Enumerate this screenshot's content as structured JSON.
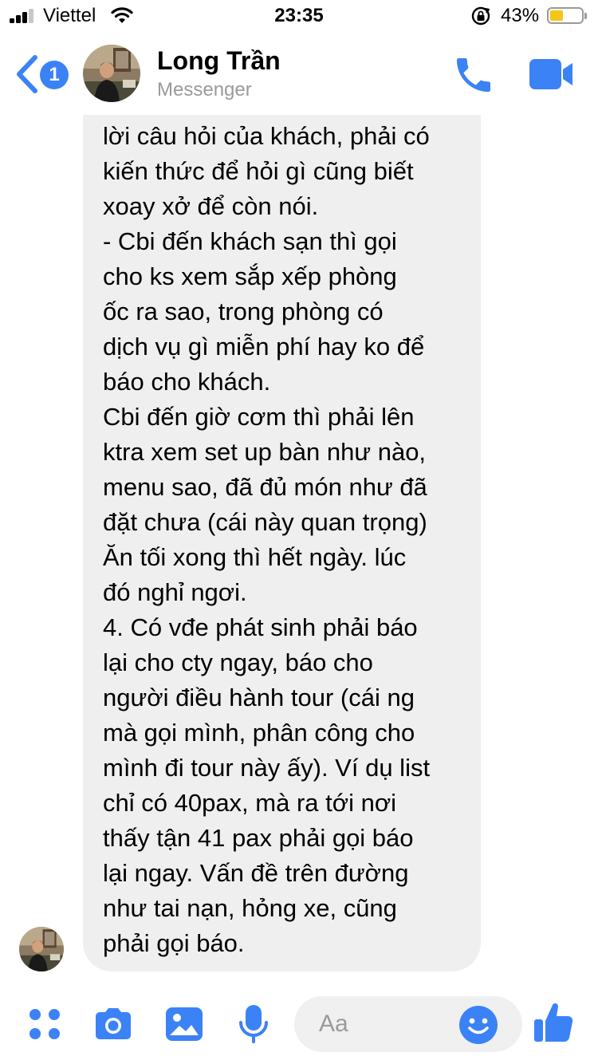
{
  "status_bar": {
    "carrier": "Viettel",
    "time": "23:35",
    "battery_percent_label": "43%",
    "battery_level": 0.43,
    "icons": [
      "signal-icon",
      "wifi-icon",
      "orientation-lock-icon",
      "battery-icon"
    ]
  },
  "header": {
    "unread_count": "1",
    "contact_name": "Long Trần",
    "contact_subtitle": "Messenger",
    "icons": [
      "back-chevron-icon",
      "phone-icon",
      "video-camera-icon"
    ]
  },
  "message": {
    "lines": [
      "lời câu hỏi của khách, phải có",
      "kiến thức để hỏi gì cũng biết",
      "xoay xở để còn nói.",
      "- Cbi đến khách sạn thì gọi",
      "cho ks xem sắp xếp phòng",
      "ốc ra sao, trong phòng có",
      "dịch vụ gì miễn phí hay ko để",
      "báo cho khách.",
      "Cbi đến giờ cơm thì phải lên",
      "ktra xem set up bàn như nào,",
      "menu sao, đã đủ món như đã",
      "đặt chưa (cái này quan trọng)",
      "Ăn tối xong thì hết ngày. lúc",
      "đó nghỉ ngơi.",
      "4. Có vđe phát sinh phải báo",
      "lại cho cty ngay, báo cho",
      "người điều hành tour (cái ng",
      "mà gọi mình, phân công cho",
      "mình đi tour này ấy). Ví dụ list",
      "chỉ có 40pax, mà ra tới nơi",
      "thấy tận 41 pax phải gọi báo",
      "lại ngay. Vấn đề trên đường",
      "như tai nạn, hỏng xe, cũng",
      "phải gọi báo."
    ]
  },
  "composer": {
    "placeholder": "Aa",
    "icons": [
      "apps-grid-icon",
      "camera-icon",
      "photo-icon",
      "microphone-icon",
      "emoji-icon",
      "thumbs-up-icon"
    ]
  },
  "colors": {
    "accent": "#3b82f6",
    "bubble": "#efefef",
    "battery_fill": "#f5c518",
    "muted_text": "#9a9a9a"
  }
}
